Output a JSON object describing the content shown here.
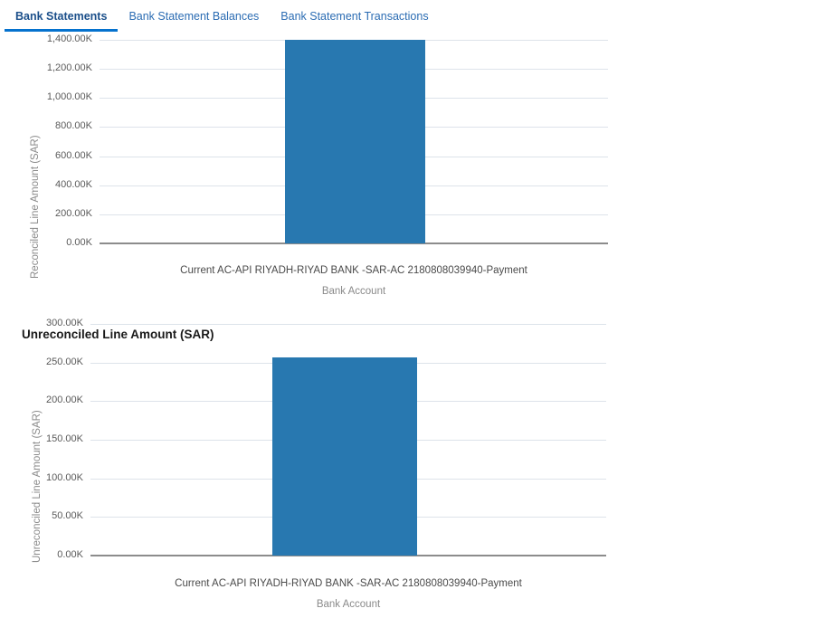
{
  "tabs": [
    {
      "label": "Bank Statements",
      "active": true
    },
    {
      "label": "Bank Statement Balances",
      "active": false
    },
    {
      "label": "Bank Statement Transactions",
      "active": false
    }
  ],
  "colors": {
    "bar": "#2878b0",
    "tab_active_underline": "#0572ce",
    "tab_active_text": "#1b4f8a",
    "tab_text": "#2b6cb3",
    "gridline": "#dde3ea",
    "axisline": "#8c8c8c"
  },
  "chart_data": [
    {
      "type": "bar",
      "title": "",
      "categories": [
        "Current AC-API RIYADH-RIYAD BANK -SAR-AC 2180808039940-Payment"
      ],
      "values": [
        1400
      ],
      "xlabel": "Bank Account",
      "ylabel": "Reconciled Line Amount (SAR)",
      "ylim": [
        0,
        1400
      ],
      "yticks": [
        0,
        200,
        400,
        600,
        800,
        1000,
        1200,
        1400
      ],
      "ytick_labels": [
        "0.00K",
        "200.00K",
        "400.00K",
        "600.00K",
        "800.00K",
        "1,000.00K",
        "1,200.00K",
        "1,400.00K"
      ],
      "grid": true,
      "legend": "none",
      "units": "K"
    },
    {
      "type": "bar",
      "title": "Unreconciled Line Amount (SAR)",
      "categories": [
        "Current AC-API RIYADH-RIYAD BANK -SAR-AC 2180808039940-Payment"
      ],
      "values": [
        257
      ],
      "xlabel": "Bank Account",
      "ylabel": "Unreconciled Line Amount (SAR)",
      "ylim": [
        0,
        300
      ],
      "yticks": [
        0,
        50,
        100,
        150,
        200,
        250,
        300
      ],
      "ytick_labels": [
        "0.00K",
        "50.00K",
        "100.00K",
        "150.00K",
        "200.00K",
        "250.00K",
        "300.00K"
      ],
      "grid": true,
      "legend": "none",
      "units": "K"
    }
  ]
}
